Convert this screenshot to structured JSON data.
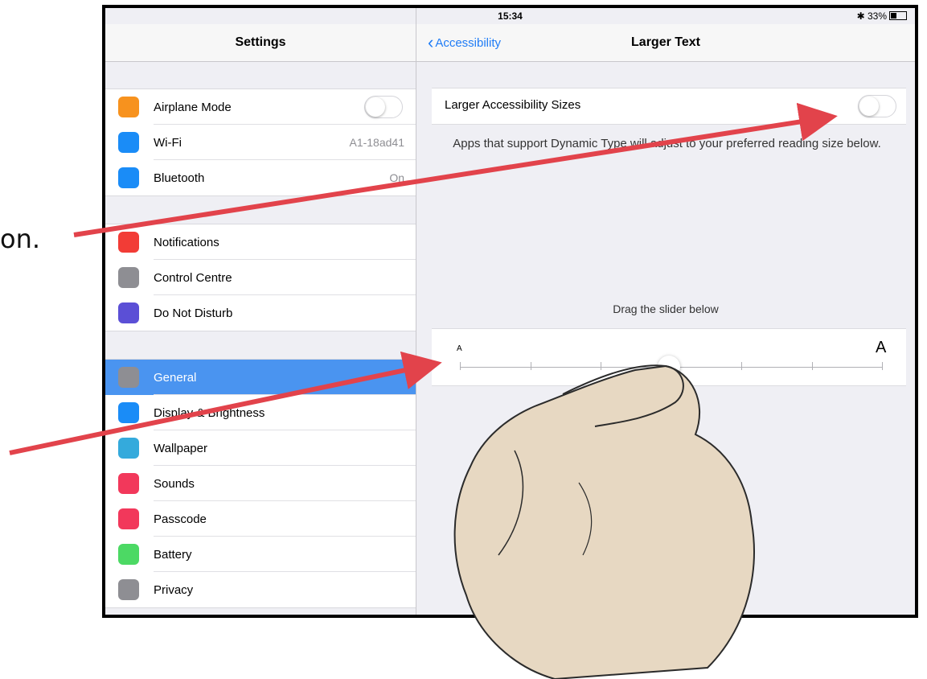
{
  "annotation": {
    "text": "on."
  },
  "status": {
    "device": "iPad",
    "time": "15:34",
    "battery": "33%"
  },
  "sidebar": {
    "title": "Settings",
    "groups": [
      [
        {
          "label": "Airplane Mode",
          "icon": "airplane-icon",
          "color": "#f7921e",
          "toggle": false
        },
        {
          "label": "Wi-Fi",
          "icon": "wifi-icon",
          "color": "#1a8cf7",
          "value": "A1-18ad41"
        },
        {
          "label": "Bluetooth",
          "icon": "bluetooth-icon",
          "color": "#1a8cf7",
          "value": "On"
        }
      ],
      [
        {
          "label": "Notifications",
          "icon": "notifications-icon",
          "color": "#f23c36"
        },
        {
          "label": "Control Centre",
          "icon": "control-centre-icon",
          "color": "#8e8e93"
        },
        {
          "label": "Do Not Disturb",
          "icon": "moon-icon",
          "color": "#5b4fd6"
        }
      ],
      [
        {
          "label": "General",
          "icon": "gear-icon",
          "color": "#8e8e93",
          "selected": true
        },
        {
          "label": "Display & Brightness",
          "icon": "display-icon",
          "color": "#1a8cf7"
        },
        {
          "label": "Wallpaper",
          "icon": "wallpaper-icon",
          "color": "#34aadc"
        },
        {
          "label": "Sounds",
          "icon": "speaker-icon",
          "color": "#f2385b"
        },
        {
          "label": "Passcode",
          "icon": "lock-icon",
          "color": "#f2385b"
        },
        {
          "label": "Battery",
          "icon": "battery-icon",
          "color": "#4cd964"
        },
        {
          "label": "Privacy",
          "icon": "hand-icon",
          "color": "#8e8e93"
        }
      ]
    ]
  },
  "detail": {
    "back_label": "Accessibility",
    "title": "Larger Text",
    "larger_sizes_label": "Larger Accessibility Sizes",
    "larger_sizes_on": false,
    "footer": "Apps that support Dynamic Type will adjust to your preferred reading size below.",
    "drag_label": "Drag the slider below",
    "slider": {
      "small_label": "A",
      "large_label": "A",
      "steps": 7,
      "value_step": 3
    }
  }
}
